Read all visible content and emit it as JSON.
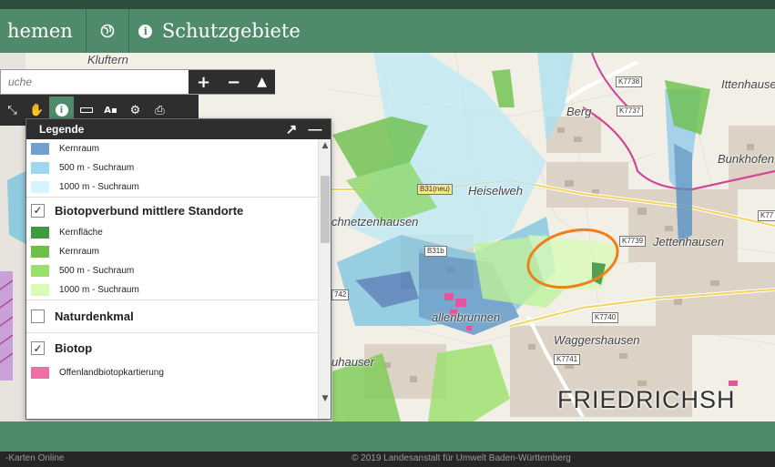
{
  "nav": {
    "themen_label": "hemen",
    "globe_icon": "globe-icon",
    "info_icon": "info-icon",
    "schutzgebiete_label": "Schutzgebiete"
  },
  "search": {
    "placeholder": "uche"
  },
  "toolbar": {
    "buttons": [
      "zoom-in",
      "zoom-out",
      "collapse"
    ],
    "tools": [
      "expand-icon",
      "pan-hand-icon",
      "info-icon",
      "measure-ruler-icon",
      "text-label-icon",
      "settings-gear-icon",
      "print-icon"
    ],
    "active_tool": "info-icon"
  },
  "legend": {
    "title": "Legende",
    "rows_top": [
      {
        "label": "Kernraum",
        "color": "#6fa0cf"
      },
      {
        "label": "500 m - Suchraum",
        "color": "#9fd6f2"
      },
      {
        "label": "1000 m - Suchraum",
        "color": "#d6f4fb"
      }
    ],
    "group1": {
      "label": "Biotopverbund mittlere Standorte",
      "checked": true
    },
    "rows_mid": [
      {
        "label": "Kernfläche",
        "color": "#3f9a3f"
      },
      {
        "label": "Kernraum",
        "color": "#6dc04a"
      },
      {
        "label": "500 m - Suchraum",
        "color": "#9be06a"
      },
      {
        "label": "1000 m - Suchraum",
        "color": "#dafbb8"
      }
    ],
    "group2": {
      "label": "Naturdenkmal",
      "checked": false
    },
    "group3": {
      "label": "Biotop",
      "checked": true
    },
    "rows_bottom": [
      {
        "label": "Offenlandbiotopkartierung",
        "color": "#ee6fa4"
      }
    ]
  },
  "map_labels": {
    "kluftern": "Kluftern",
    "berg": "Berg",
    "ittenhause": "Ittenhause",
    "bunkhofen": "Bunkhofen",
    "heiselweh": "Heiselweh",
    "schnetzenhausen": "chnetzenhausen",
    "jettenhausen": "Jettenhausen",
    "allenbrunnen": "allenbrunnen",
    "waggershausen": "Waggershausen",
    "uhauser": "uhauser",
    "city": "FRIEDRICHSH",
    "road_k7738": "K7738",
    "road_k7737": "K7737",
    "road_b31": "B31(neu)",
    "road_k7739": "K7739",
    "road_k7740": "K7740",
    "road_k7741": "K7741",
    "road_b31b": "B31b",
    "road_742": "742",
    "road_k77": "K77"
  },
  "footer": {
    "left": "-Karten Online",
    "center": "© 2019 Landesanstalt für Umwelt Baden-Württemberg"
  },
  "colors": {
    "header": "#4f8a6a",
    "highlight_ellipse": "#f07f1a"
  }
}
